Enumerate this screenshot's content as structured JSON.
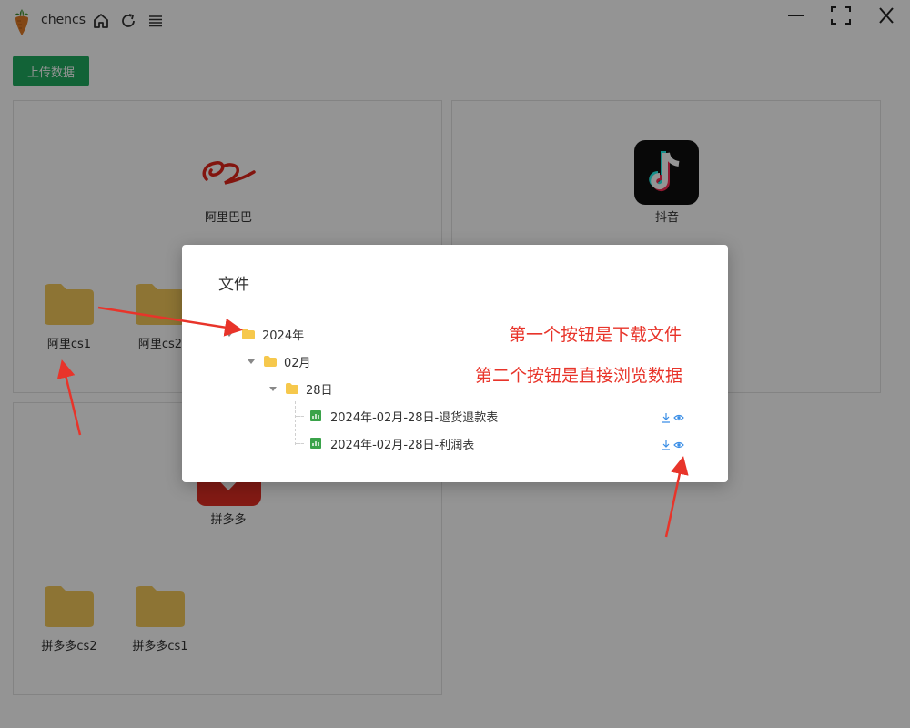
{
  "titlebar": {
    "username": "chencs",
    "icons": [
      "home-icon",
      "refresh-icon",
      "menu-icon"
    ],
    "window_controls": [
      "minimize-icon",
      "maximize-icon",
      "close-icon"
    ]
  },
  "toolbar": {
    "upload_label": "上传数据"
  },
  "panels": [
    {
      "name": "阿里巴巴",
      "logo": "alibaba-logo",
      "folders": [
        "阿里cs1",
        "阿里cs2"
      ]
    },
    {
      "name": "抖音",
      "logo": "douyin-logo",
      "folders": []
    },
    {
      "name": "拼多多",
      "logo": "pinduoduo-logo",
      "folders": [
        "拼多多cs2",
        "拼多多cs1"
      ]
    }
  ],
  "modal": {
    "title": "文件",
    "tree": {
      "year": "2024年",
      "month": "02月",
      "day": "28日",
      "files": [
        {
          "name": "2024年-02月-28日-退货退款表",
          "actions": [
            "download-icon",
            "view-icon"
          ]
        },
        {
          "name": "2024年-02月-28日-利润表",
          "actions": [
            "download-icon",
            "view-icon"
          ]
        }
      ]
    }
  },
  "annotations": {
    "note1": "第一个按钮是下载文件",
    "note2": "第二个按钮是直接浏览数据"
  },
  "colors": {
    "accent_green": "#1fab5f",
    "folder_yellow": "#f3c85a",
    "annotation_red": "#e8342a",
    "action_blue": "#3a8ee6",
    "file_green": "#3aa34a"
  }
}
